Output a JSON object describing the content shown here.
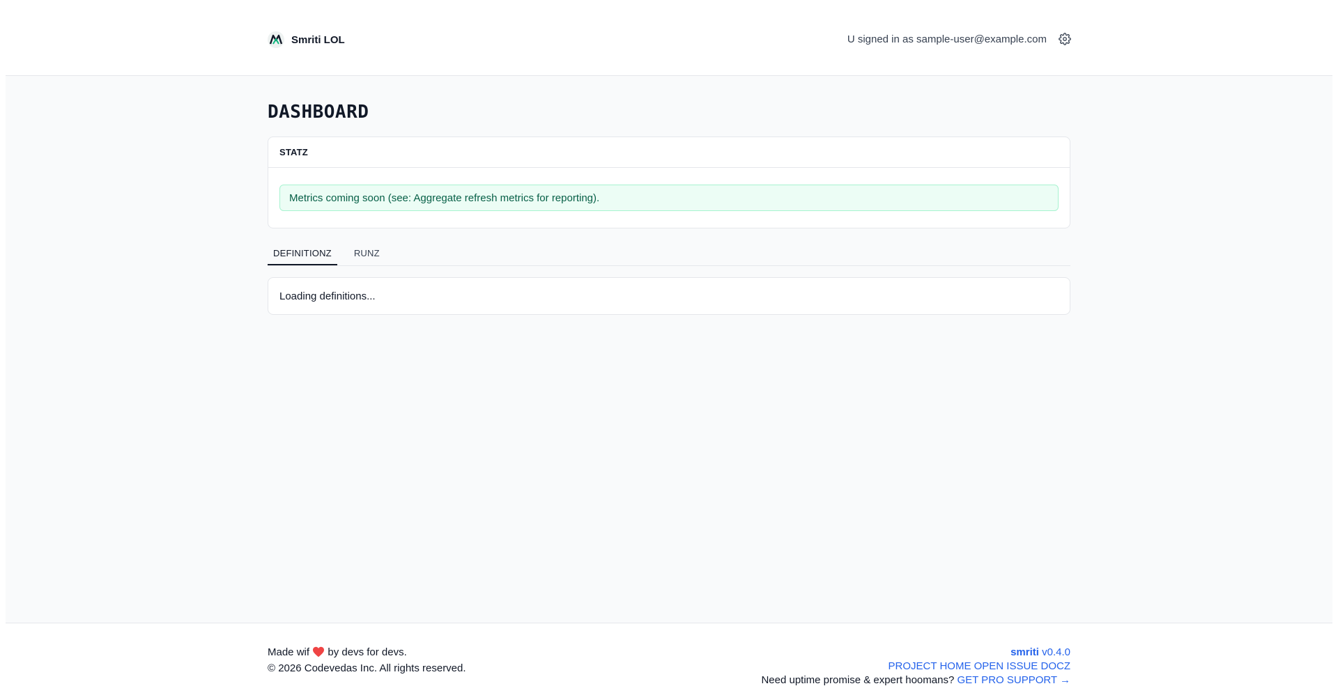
{
  "header": {
    "brand_name": "Smriti LOL",
    "signed_in_text": "U signed in as sample-user@example.com"
  },
  "main": {
    "page_title": "DASHBOARD",
    "stats": {
      "title": "STATZ",
      "notice": "Metrics coming soon (see: Aggregate refresh metrics for reporting)."
    },
    "tabs": [
      {
        "label": "DEFINITIONZ",
        "active": true
      },
      {
        "label": "RUNZ",
        "active": false
      }
    ],
    "loading_text": "Loading definitions..."
  },
  "footer": {
    "made_prefix": "Made wif",
    "made_suffix": "by devs for devs.",
    "copyright": "© 2026 Codevedas Inc. All rights reserved.",
    "app_name": "smriti",
    "version": "v0.4.0",
    "links": [
      "PROJECT HOME",
      "OPEN ISSUE",
      "DOCZ"
    ],
    "support_prompt": "Need uptime promise & expert hoomans?",
    "support_link": "GET PRO SUPPORT →"
  },
  "colors": {
    "accent": "#2563eb",
    "notice_bg": "#ecfdf5",
    "notice_text": "#065f46",
    "heart": "#ef4444"
  },
  "icons": {
    "logo": "m-logo-icon",
    "settings": "gear-icon",
    "heart": "heart-icon"
  }
}
